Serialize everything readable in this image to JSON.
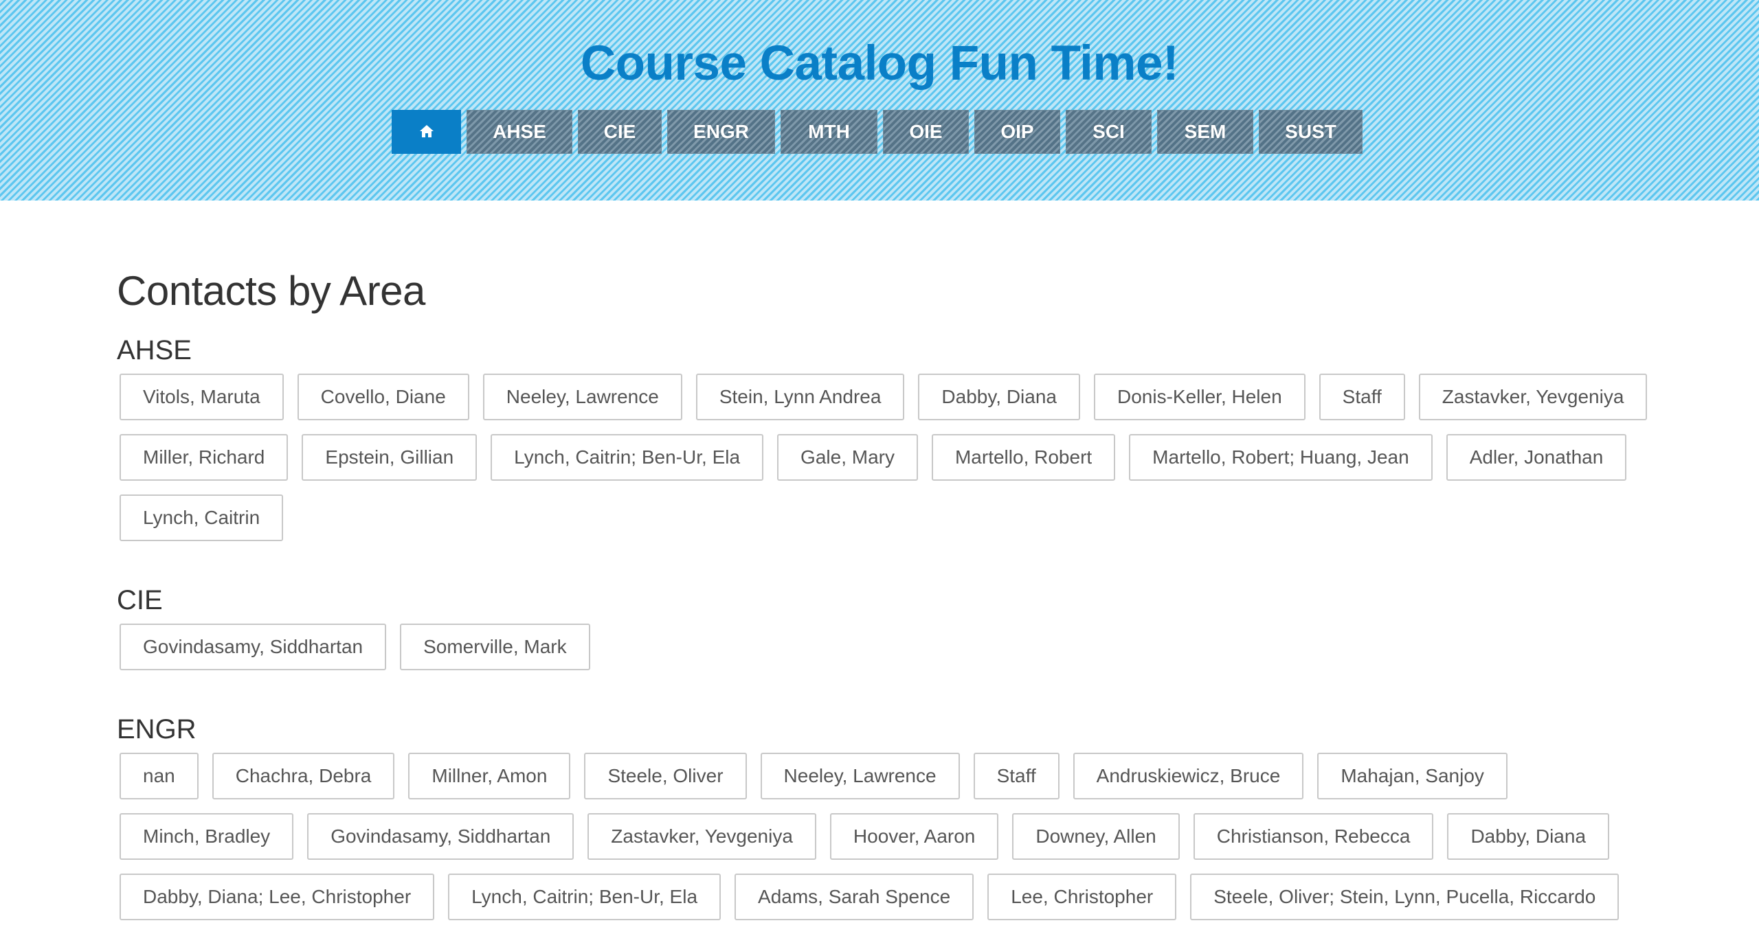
{
  "header": {
    "title": "Course Catalog Fun Time!",
    "nav": [
      {
        "label": "AHSE"
      },
      {
        "label": "CIE"
      },
      {
        "label": "ENGR"
      },
      {
        "label": "MTH"
      },
      {
        "label": "OIE"
      },
      {
        "label": "OIP"
      },
      {
        "label": "SCI"
      },
      {
        "label": "SEM"
      },
      {
        "label": "SUST"
      }
    ],
    "home_icon": "home-icon",
    "accent_color": "#0a7fc7"
  },
  "main": {
    "title": "Contacts by Area",
    "sections": [
      {
        "name": "AHSE",
        "contacts": [
          "Vitols, Maruta",
          "Covello, Diane",
          "Neeley, Lawrence",
          "Stein, Lynn Andrea",
          "Dabby, Diana",
          "Donis-Keller, Helen",
          "Staff",
          "Zastavker, Yevgeniya",
          "Miller, Richard",
          "Epstein, Gillian",
          "Lynch, Caitrin; Ben-Ur, Ela",
          "Gale, Mary",
          "Martello, Robert",
          "Martello, Robert; Huang, Jean",
          "Adler, Jonathan",
          "Lynch, Caitrin"
        ]
      },
      {
        "name": "CIE",
        "contacts": [
          "Govindasamy, Siddhartan",
          "Somerville, Mark"
        ]
      },
      {
        "name": "ENGR",
        "contacts": [
          "nan",
          "Chachra, Debra",
          "Millner, Amon",
          "Steele, Oliver",
          "Neeley, Lawrence",
          "Staff",
          "Andruskiewicz, Bruce",
          "Mahajan, Sanjoy",
          "Minch, Bradley",
          "Govindasamy, Siddhartan",
          "Zastavker, Yevgeniya",
          "Hoover, Aaron",
          "Downey, Allen",
          "Christianson, Rebecca",
          "Dabby, Diana",
          "Dabby, Diana; Lee, Christopher",
          "Lynch, Caitrin; Ben-Ur, Ela",
          "Adams, Sarah Spence",
          "Lee, Christopher",
          "Steele, Oliver; Stein, Lynn, Pucella, Riccardo"
        ]
      }
    ]
  }
}
